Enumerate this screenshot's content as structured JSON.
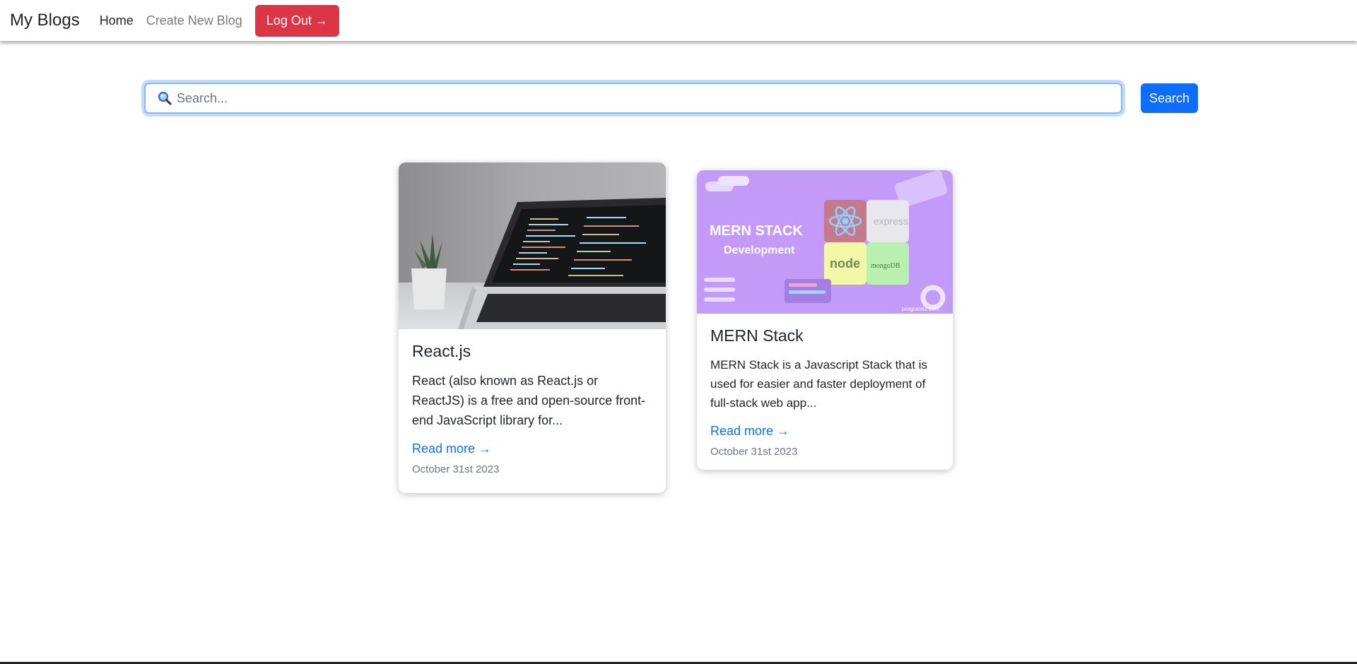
{
  "nav": {
    "brand": "My Blogs",
    "links": [
      "Home",
      "Create New Blog"
    ],
    "logout_label": "Log Out →"
  },
  "search": {
    "placeholder": "Search...",
    "value": "",
    "button_label": "Search",
    "icon": "search-icon"
  },
  "posts": [
    {
      "title": "React.js",
      "excerpt": "React (also known as React.js or ReactJS) is a free and open-source front-end JavaScript library for...",
      "read_more": "Read more →",
      "date": "October 31st 2023",
      "image": "laptop-code-photo"
    },
    {
      "title": "MERN Stack",
      "excerpt": "MERN Stack is a Javascript Stack that is used for easier and faster deployment of full-stack web app...",
      "read_more": "Read more →",
      "date": "October 31st 2023",
      "image": "mern-stack-banner",
      "image_text": {
        "heading": "MERN STACK",
        "subheading": "Development",
        "badges": [
          "express",
          "node",
          "mongoDB"
        ],
        "watermark": "programiz.com"
      }
    }
  ],
  "colors": {
    "primary": "#0d6efd",
    "danger": "#dc3545",
    "muted": "#6c757d",
    "mern_purple": "#c39af7"
  }
}
